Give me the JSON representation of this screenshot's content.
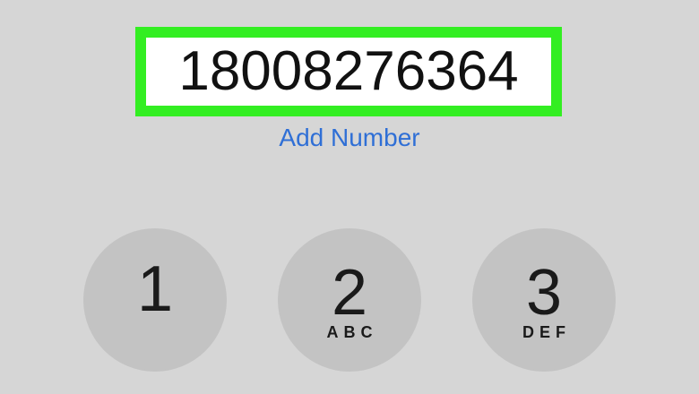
{
  "display": {
    "dialed_number": "18008276364",
    "highlight_color": "#33ee22"
  },
  "add_number": {
    "label": "Add Number",
    "color": "#2f6fd6"
  },
  "keypad": {
    "keys": [
      {
        "digit": "1",
        "letters": ""
      },
      {
        "digit": "2",
        "letters": "ABC"
      },
      {
        "digit": "3",
        "letters": "DEF"
      }
    ]
  },
  "colors": {
    "background": "#d6d6d6",
    "key_fill": "#c3c3c3"
  }
}
